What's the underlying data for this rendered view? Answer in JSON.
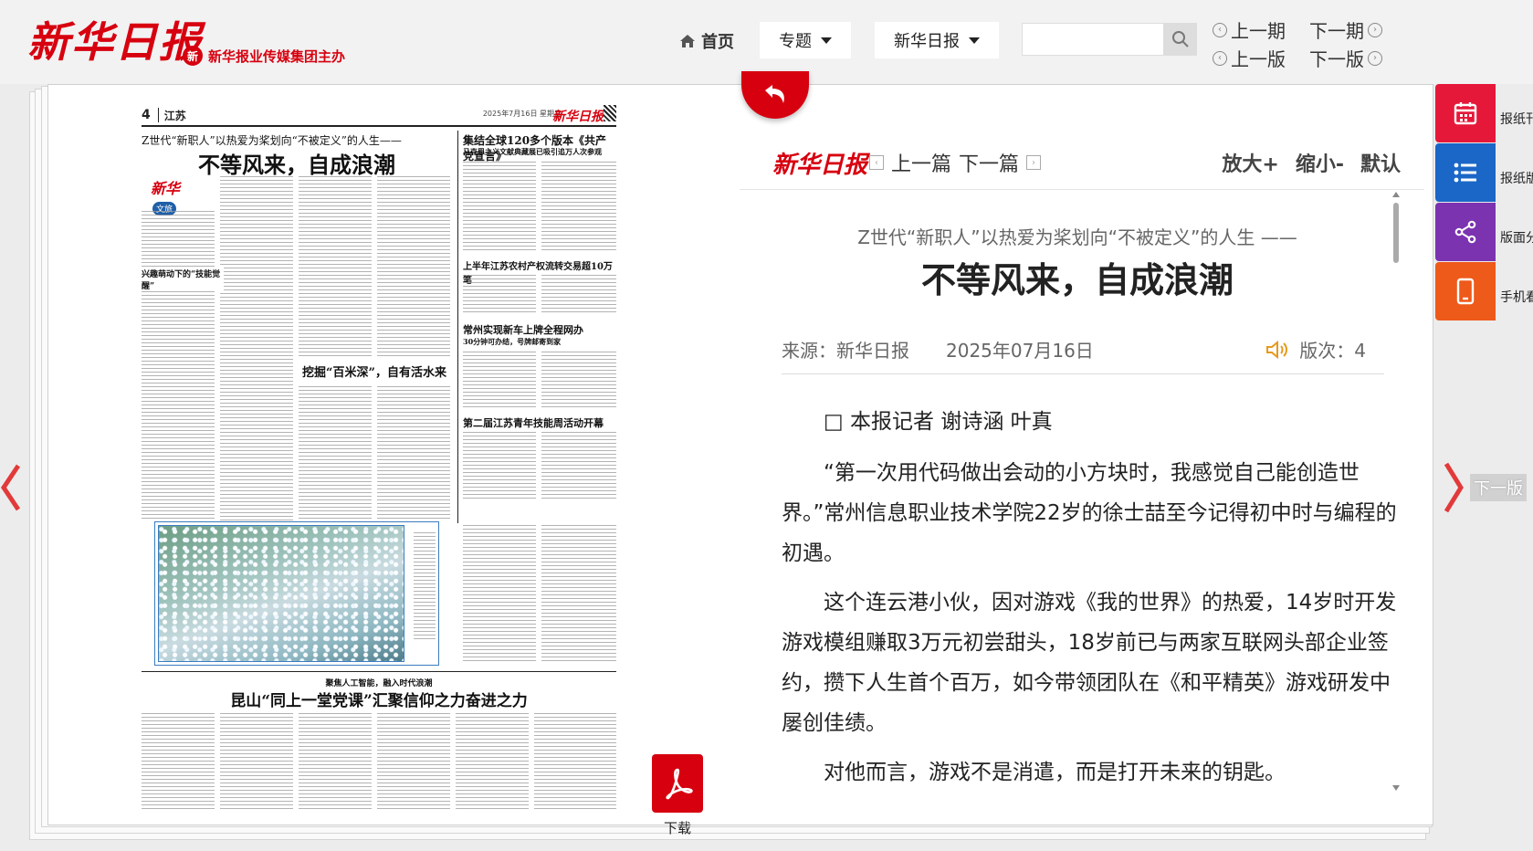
{
  "header": {
    "logo": "新华日报",
    "sponsor_badge": "新",
    "sponsor": "新华报业传媒集团主办",
    "home": "首页",
    "dropdown_topic": "专题",
    "dropdown_paper": "新华日报",
    "search_placeholder": "",
    "prev_issue": "上一期",
    "next_issue": "下一期",
    "prev_page": "上一版",
    "next_page": "下一版"
  },
  "newspaper": {
    "page_no": "4",
    "section": "江苏",
    "date_line": "2025年7月16日 星期三",
    "mini_logo": "新华日报",
    "kicker": "Z世代“新职人”以热爱为桨划向“不被定义”的人生——",
    "headline": "不等风来，自成浪潮",
    "badge_a": "新华",
    "badge_b": "文旅",
    "sub1": "兴趣萌动下的“技能觉醒”",
    "sub2": "挖掘“百米深”，自有活水来",
    "right1_title": "集结全球120多个版本《共产党宣言》",
    "right1_sub": "马克思主义文献典藏展已吸引追万人次参观",
    "right2_title": "上半年江苏农村产权流转交易超10万笔",
    "right3_title": "常州实现新车上牌全程网办",
    "right3_sub": "30分钟可办结，号牌邮寄到家",
    "right4_title": "第二届江苏青年技能周活动开幕",
    "bottom_kicker": "聚焦人工智能，融入时代浪潮",
    "bottom_headline": "昆山“同上一堂党课”汇聚信仰之力奋进之力"
  },
  "pdf": {
    "label": "下载"
  },
  "article": {
    "logo": "新华日报",
    "prev": "上一篇",
    "next": "下一篇",
    "zoom_in": "放大+",
    "zoom_out": "缩小-",
    "reset": "默认",
    "subtitle": "Z世代“新职人”以热爱为桨划向“不被定义”的人生 ——",
    "title": "不等风来，自成浪潮",
    "source": "来源：新华日报",
    "date": "2025年07月16日",
    "edition": "版次：4",
    "byline": "□ 本报记者 谢诗涵 叶真",
    "paragraphs": [
      "“第一次用代码做出会动的小方块时，我感觉自己能创造世界。”常州信息职业技术学院22岁的徐士喆至今记得初中时与编程的初遇。",
      "这个连云港小伙，因对游戏《我的世界》的热爱，14岁时开发游戏模组赚取3万元初尝甜头，18岁前已与两家互联网头部企业签约，攒下人生首个百万，如今带领团队在《和平精英》游戏研发中屡创佳绩。",
      "对他而言，游戏不是消遣，而是打开未来的钥匙。"
    ]
  },
  "side": {
    "next_page": "下一版"
  },
  "float_menu": [
    {
      "label": "报纸刊期",
      "icon": "calendar-icon",
      "color": "#e5183a"
    },
    {
      "label": "报纸版面",
      "icon": "list-icon",
      "color": "#1a67c7"
    },
    {
      "label": "版面分享",
      "icon": "share-icon",
      "color": "#7b33b0"
    },
    {
      "label": "手机看报",
      "icon": "phone-icon",
      "color": "#ee5a1a"
    }
  ]
}
